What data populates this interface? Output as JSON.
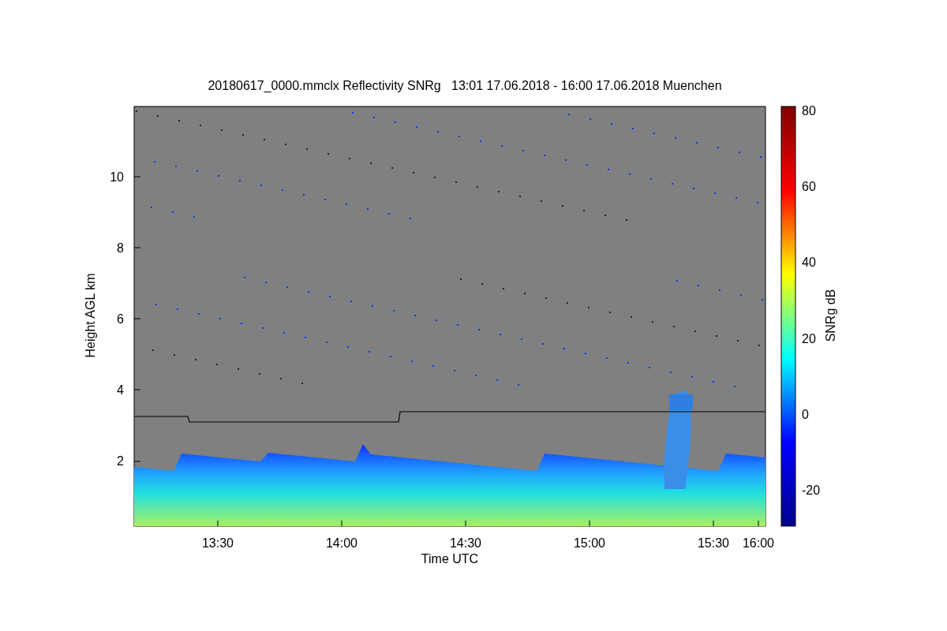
{
  "chart": {
    "title": "20180617_0000.mmclx Reflectivity SNRg   13:01 17.06.2018 - 16:00 17.06.2018 Muenchen",
    "x_axis": {
      "label": "Time UTC",
      "ticks": [
        "13:30",
        "14:00",
        "14:30",
        "15:00",
        "15:30",
        "16:00"
      ]
    },
    "y_axis": {
      "label": "Height AGL km",
      "ticks": [
        "10",
        "8",
        "6",
        "4",
        "2"
      ]
    },
    "colorbar": {
      "label": "SNRg dB",
      "ticks": [
        "80",
        "60",
        "40",
        "20",
        "0",
        "-20"
      ]
    }
  }
}
